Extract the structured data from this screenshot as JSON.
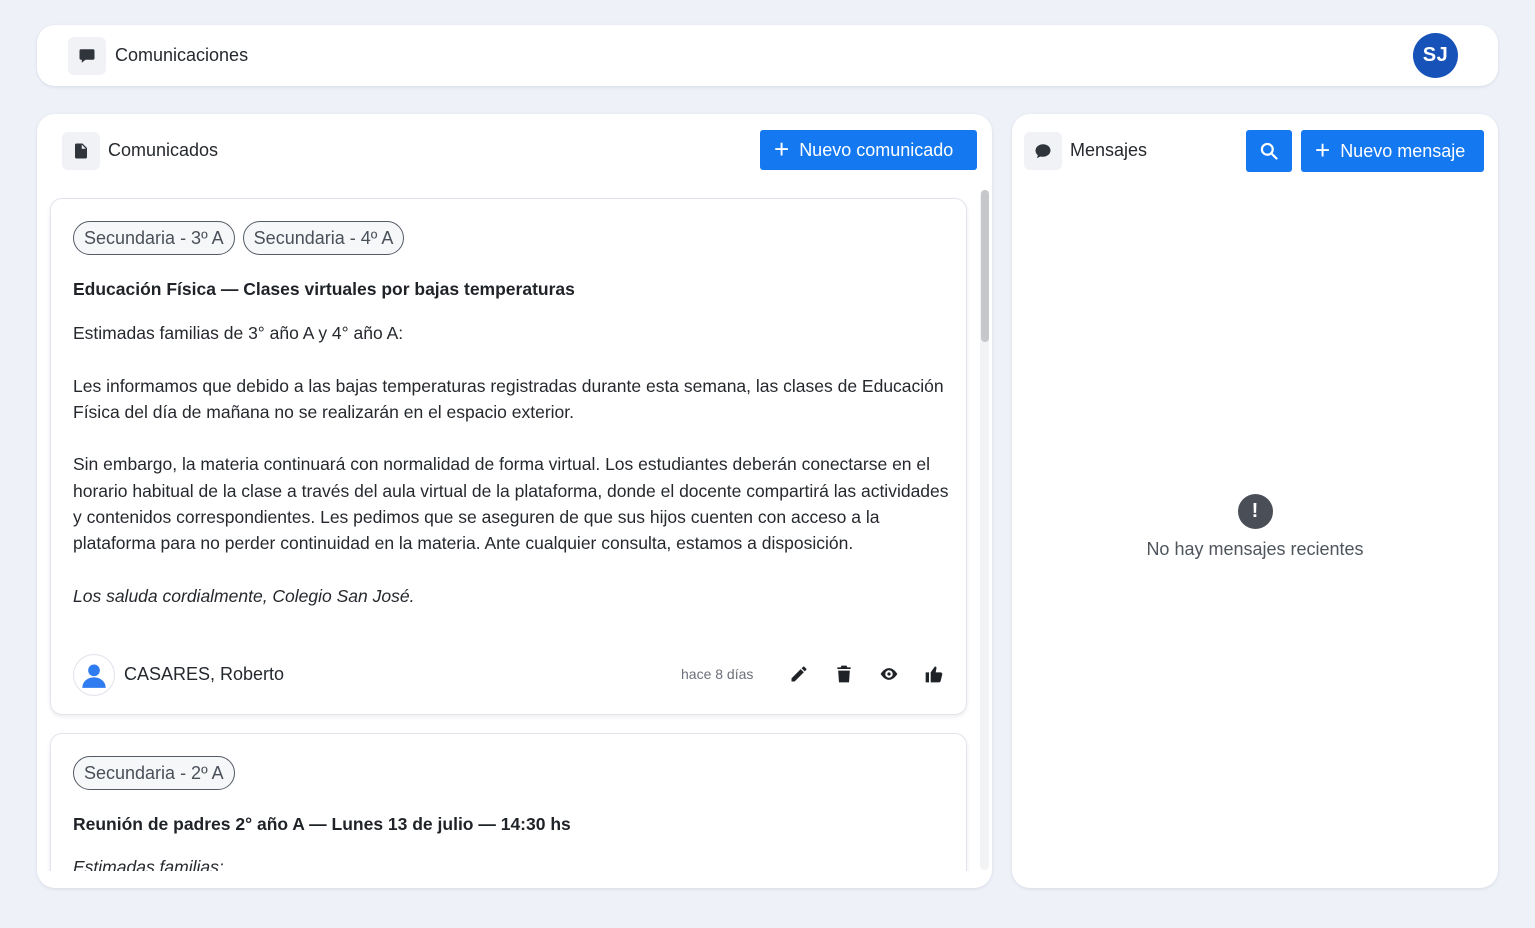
{
  "topbar": {
    "title": "Comunicaciones",
    "icon": "chat-bubble-icon",
    "avatar_initials": "SJ",
    "avatar_color": "#1652b7"
  },
  "announcements": {
    "title": "Comunicados",
    "icon": "document-icon",
    "new_button_label": "Nuevo comunicado",
    "accent_color": "#1478f0",
    "posts": [
      {
        "tags": [
          "Secundaria - 3º A",
          "Secundaria - 4º A"
        ],
        "title": "Educación Física — Clases virtuales por bajas temperaturas",
        "paragraphs": [
          "Estimadas familias de 3° año A y 4° año A:",
          "Les informamos que debido a las bajas temperaturas registradas durante esta semana, las clases de Educación Física del día de mañana no se realizarán en el espacio exterior.",
          "Sin embargo, la materia continuará con normalidad de forma virtual. Los estudiantes deberán conectarse en el horario habitual de la clase a través del aula virtual de la plataforma, donde el docente compartirá las actividades y contenidos correspondientes. Les pedimos que se aseguren de que sus hijos cuenten con acceso a la plataforma para no perder continuidad en la materia. Ante cualquier consulta, estamos a disposición."
        ],
        "closing": "Los saluda cordialmente, Colegio San José.",
        "author": "CASARES, Roberto",
        "time": "hace 8 días"
      },
      {
        "tags": [
          "Secundaria - 2º A"
        ],
        "title": "Reunión de padres 2° año A — Lunes 13 de julio — 14:30 hs",
        "preview": "Estimadas familias:"
      }
    ]
  },
  "messages": {
    "title": "Mensajes",
    "icon": "speech-bubble-icon",
    "new_button_label": "Nuevo mensaje",
    "empty_icon_glyph": "!",
    "empty_text": "No hay mensajes recientes"
  }
}
